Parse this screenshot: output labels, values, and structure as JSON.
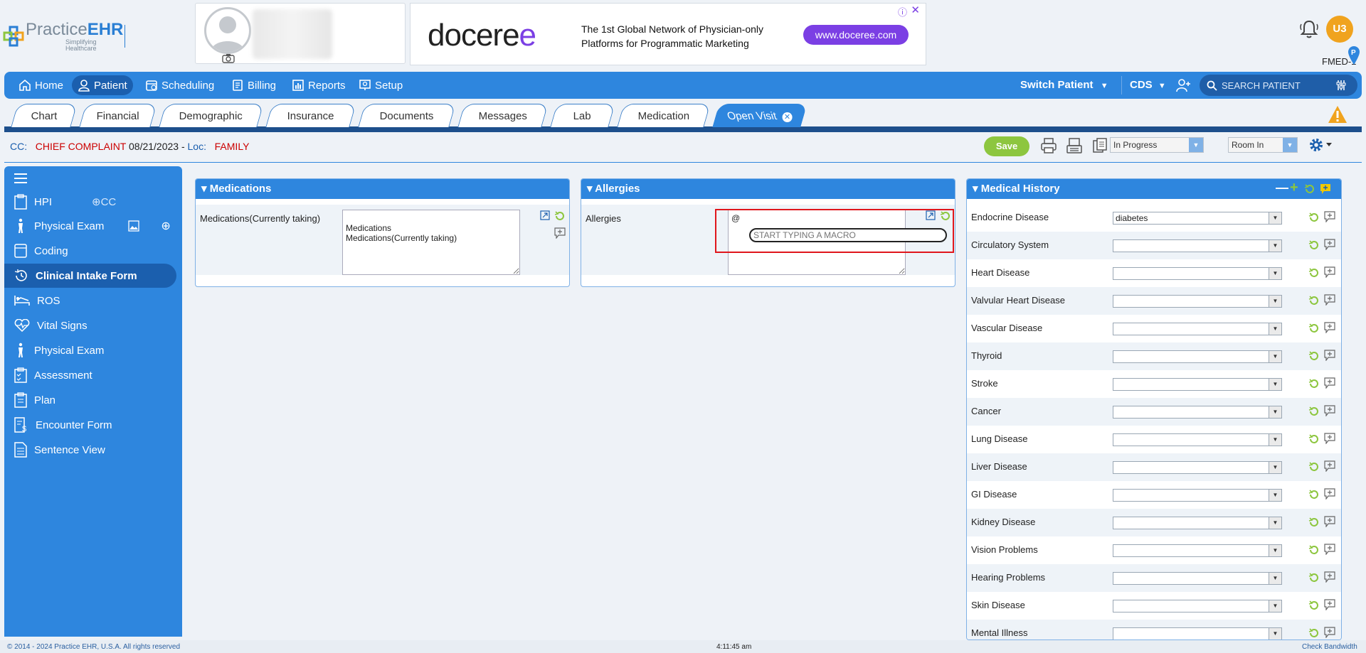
{
  "brand": {
    "name_prefix": "Practice",
    "name_suffix": "EHR",
    "tagline": "Simplifying Healthcare"
  },
  "ad": {
    "logo_text": "docere",
    "logo_tail": "e",
    "line1": "The 1st Global Network of Physician-only",
    "line2": "Platforms for Programmatic Marketing",
    "button": "www.doceree.com"
  },
  "user": {
    "initials": "U3",
    "facility": "FMED-1"
  },
  "nav": {
    "items": [
      {
        "label": "Home"
      },
      {
        "label": "Patient"
      },
      {
        "label": "Scheduling"
      },
      {
        "label": "Billing"
      },
      {
        "label": "Reports"
      },
      {
        "label": "Setup"
      }
    ],
    "switch_patient": "Switch Patient",
    "cds": "CDS",
    "search_placeholder": "SEARCH PATIENT"
  },
  "tabs": [
    "Chart",
    "Financial",
    "Demographic",
    "Insurance",
    "Documents",
    "Messages",
    "Lab",
    "Medication",
    "Open Visit"
  ],
  "cc": {
    "label": "CC:",
    "complaint": "CHIEF COMPLAINT",
    "date": "08/21/2023 -",
    "loc_label": "Loc:",
    "loc": "FAMILY"
  },
  "toolbar": {
    "save": "Save",
    "status": "In Progress",
    "room": "Room In"
  },
  "sidebar": {
    "items": [
      "HPI",
      "Physical Exam",
      "Coding",
      "Clinical Intake Form",
      "ROS",
      "Vital Signs",
      "Physical Exam",
      "Assessment",
      "Plan",
      "Encounter Form",
      "Sentence View"
    ],
    "cc_badge": "CC"
  },
  "medications": {
    "title": "Medications",
    "label": "Medications(Currently taking)",
    "value": "\nMedications\nMedications(Currently taking)"
  },
  "allergies": {
    "title": "Allergies",
    "label": "Allergies",
    "value": "@",
    "macro_placeholder": "START TYPING A MACRO"
  },
  "history": {
    "title": "Medical History",
    "rows": [
      {
        "label": "Endocrine Disease",
        "value": "diabetes"
      },
      {
        "label": "Circulatory System",
        "value": ""
      },
      {
        "label": "Heart Disease",
        "value": ""
      },
      {
        "label": "Valvular Heart Disease",
        "value": ""
      },
      {
        "label": "Vascular Disease",
        "value": ""
      },
      {
        "label": "Thyroid",
        "value": ""
      },
      {
        "label": "Stroke",
        "value": ""
      },
      {
        "label": "Cancer",
        "value": ""
      },
      {
        "label": "Lung Disease",
        "value": ""
      },
      {
        "label": "Liver Disease",
        "value": ""
      },
      {
        "label": "GI Disease",
        "value": ""
      },
      {
        "label": "Kidney Disease",
        "value": ""
      },
      {
        "label": "Vision Problems",
        "value": ""
      },
      {
        "label": "Hearing Problems",
        "value": ""
      },
      {
        "label": "Skin Disease",
        "value": ""
      },
      {
        "label": "Mental Illness",
        "value": ""
      }
    ]
  },
  "footer": {
    "copyright": "© 2014 - 2024 Practice EHR, U.S.A. All rights reserved",
    "time": "4:11:45 am",
    "bandwidth": "Check Bandwidth"
  },
  "colors": {
    "primary": "#2e86de",
    "dark": "#1b5fae",
    "save": "#8dc63f",
    "alert": "#c00"
  }
}
